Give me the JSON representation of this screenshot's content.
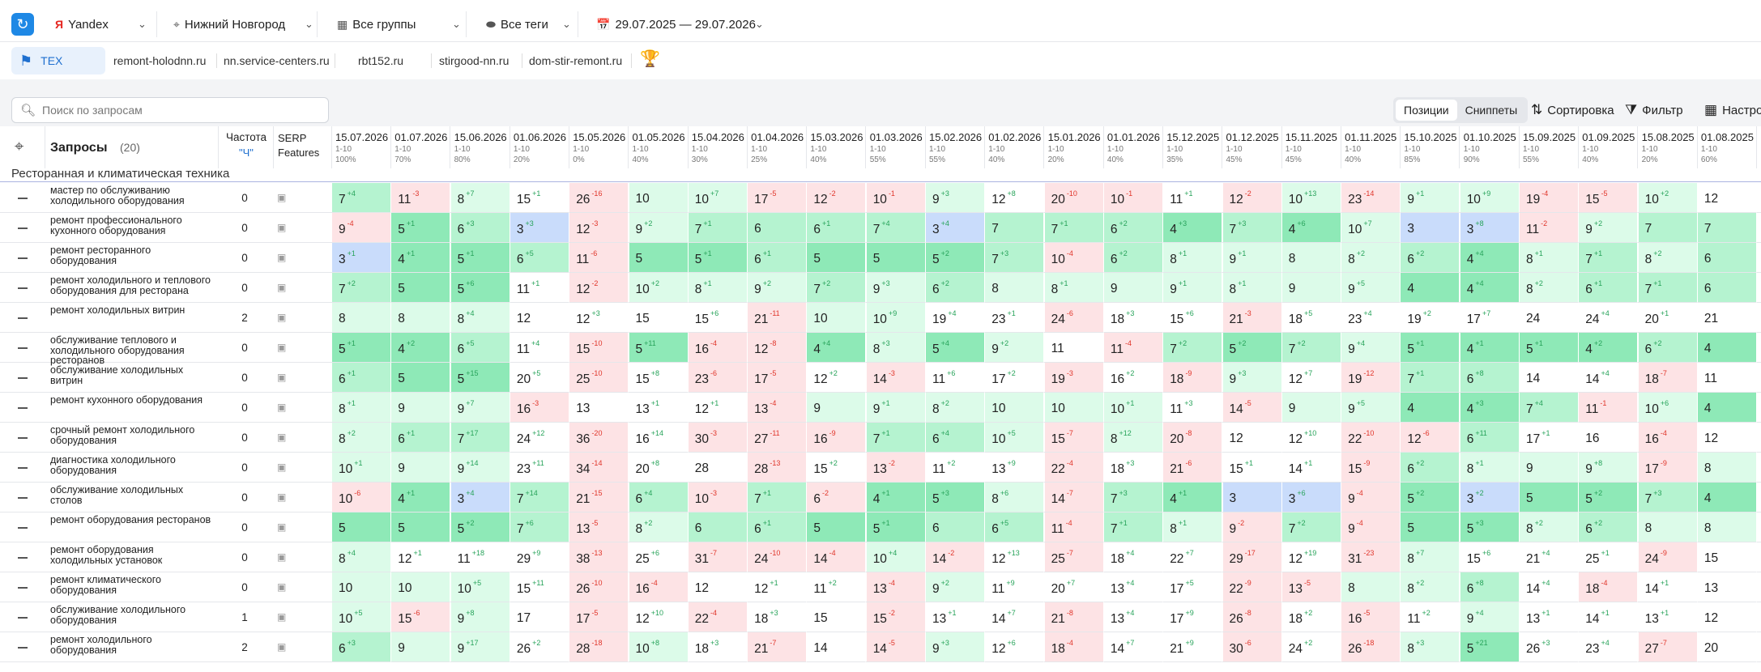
{
  "filters": {
    "engine": "Yandex",
    "region": "Нижний Новгород",
    "groups": "Все группы",
    "tags": "Все теги",
    "dates": "29.07.2025 — 29.07.2026"
  },
  "projects": [
    "TEX",
    "remont-holodnn.ru",
    "nn.service-centers.ru",
    "rbt152.ru",
    "stirgood-nn.ru",
    "dom-stir-remont.ru"
  ],
  "toolbar": {
    "search_placeholder": "Поиск по запросам",
    "positions": "Позиции",
    "snippets": "Сниппеты",
    "sort": "Сортировка",
    "filter": "Фильтр",
    "settings": "Настро"
  },
  "table": {
    "col_queries": "Запросы",
    "queries_count": "(20)",
    "col_freq": "Частота",
    "freq_sub": "\"Ч\"",
    "col_serp": "SERP Features",
    "group": "Ресторанная и климатическая техника",
    "dates": [
      {
        "d": "15.07.2026",
        "r": "1-10",
        "p": "100%"
      },
      {
        "d": "01.07.2026",
        "r": "1-10",
        "p": "70%"
      },
      {
        "d": "15.06.2026",
        "r": "1-10",
        "p": "80%"
      },
      {
        "d": "01.06.2026",
        "r": "1-10",
        "p": "20%"
      },
      {
        "d": "15.05.2026",
        "r": "1-10",
        "p": "0%"
      },
      {
        "d": "01.05.2026",
        "r": "1-10",
        "p": "40%"
      },
      {
        "d": "15.04.2026",
        "r": "1-10",
        "p": "30%"
      },
      {
        "d": "01.04.2026",
        "r": "1-10",
        "p": "25%"
      },
      {
        "d": "15.03.2026",
        "r": "1-10",
        "p": "40%"
      },
      {
        "d": "01.03.2026",
        "r": "1-10",
        "p": "55%"
      },
      {
        "d": "15.02.2026",
        "r": "1-10",
        "p": "55%"
      },
      {
        "d": "01.02.2026",
        "r": "1-10",
        "p": "40%"
      },
      {
        "d": "15.01.2026",
        "r": "1-10",
        "p": "20%"
      },
      {
        "d": "01.01.2026",
        "r": "1-10",
        "p": "40%"
      },
      {
        "d": "15.12.2025",
        "r": "1-10",
        "p": "35%"
      },
      {
        "d": "01.12.2025",
        "r": "1-10",
        "p": "45%"
      },
      {
        "d": "15.11.2025",
        "r": "1-10",
        "p": "45%"
      },
      {
        "d": "01.11.2025",
        "r": "1-10",
        "p": "40%"
      },
      {
        "d": "15.10.2025",
        "r": "1-10",
        "p": "85%"
      },
      {
        "d": "01.10.2025",
        "r": "1-10",
        "p": "90%"
      },
      {
        "d": "15.09.2025",
        "r": "1-10",
        "p": "55%"
      },
      {
        "d": "01.09.2025",
        "r": "1-10",
        "p": "40%"
      },
      {
        "d": "15.08.2025",
        "r": "1-10",
        "p": "20%"
      },
      {
        "d": "01.08.2025",
        "r": "1-10",
        "p": "60%"
      }
    ],
    "rows": [
      {
        "q": "мастер по обслуживанию холодильного оборудования",
        "f": "0",
        "c": [
          "7 +4",
          "11 -3",
          "8 +7",
          "15 +1",
          "26 -16",
          "10",
          "10 +7",
          "17 -5",
          "12 -2",
          "10 -1",
          "9 +3",
          "12 +8",
          "20 -10",
          "10 -1",
          "11 +1",
          "12 -2",
          "10 +13",
          "23 -14",
          "9 +1",
          "10 +9",
          "19 -4",
          "15 -5",
          "10 +2",
          "12"
        ]
      },
      {
        "q": "ремонт профессионального кухонного оборудования",
        "f": "0",
        "c": [
          "9 -4",
          "5 +1",
          "6 +3",
          "3 +3",
          "12 -3",
          "9 +2",
          "7 +1",
          "6",
          "6 +1",
          "7 +4",
          "3 +4",
          "7",
          "7 +1",
          "6 +2",
          "4 +3",
          "7 +3",
          "4 +6",
          "10 +7",
          "3",
          "3 +8",
          "11 -2",
          "9 +2",
          "7",
          "7"
        ]
      },
      {
        "q": "ремонт ресторанного оборудования",
        "f": "0",
        "c": [
          "3 +1",
          "4 +1",
          "5 +1",
          "6 +5",
          "11 -6",
          "5",
          "5 +1",
          "6 +1",
          "5",
          "5",
          "5 +2",
          "7 +3",
          "10 -4",
          "6 +2",
          "8 +1",
          "9 +1",
          "8",
          "8 +2",
          "6 +2",
          "4 +4",
          "8 +1",
          "7 +1",
          "8 +2",
          "6"
        ]
      },
      {
        "q": "ремонт холодильного и теплового оборудования для ресторана",
        "f": "0",
        "c": [
          "7 +2",
          "5",
          "5 +6",
          "11 +1",
          "12 -2",
          "10 +2",
          "8 +1",
          "9 +2",
          "7 +2",
          "9 +3",
          "6 +2",
          "8",
          "8 +1",
          "9",
          "9 +1",
          "8 +1",
          "9",
          "9 +5",
          "4",
          "4 +4",
          "8 +2",
          "6 +1",
          "7 +1",
          "6"
        ]
      },
      {
        "q": "ремонт холодильных витрин",
        "f": "2",
        "c": [
          "8",
          "8",
          "8 +4",
          "12",
          "12 +3",
          "15",
          "15 +6",
          "21 -11",
          "10",
          "10 +9",
          "19 +4",
          "23 +1",
          "24 -6",
          "18 +3",
          "15 +6",
          "21 -3",
          "18 +5",
          "23 +4",
          "19 +2",
          "17 +7",
          "24",
          "24 +4",
          "20 +1",
          "21"
        ]
      },
      {
        "q": "обслуживание теплового и холодильного оборудования ресторанов",
        "f": "0",
        "c": [
          "5 +1",
          "4 +2",
          "6 +5",
          "11 +4",
          "15 -10",
          "5 +11",
          "16 -4",
          "12 -8",
          "4 +4",
          "8 +3",
          "5 +4",
          "9 +2",
          "11",
          "11 -4",
          "7 +2",
          "5 +2",
          "7 +2",
          "9 +4",
          "5 +1",
          "4 +1",
          "5 +1",
          "4 +2",
          "6 +2",
          "4"
        ]
      },
      {
        "q": "обслуживание холодильных витрин",
        "f": "0",
        "c": [
          "6 +1",
          "5",
          "5 +15",
          "20 +5",
          "25 -10",
          "15 +8",
          "23 -6",
          "17 -5",
          "12 +2",
          "14 -3",
          "11 +6",
          "17 +2",
          "19 -3",
          "16 +2",
          "18 -9",
          "9 +3",
          "12 +7",
          "19 -12",
          "7 +1",
          "6 +8",
          "14",
          "14 +4",
          "18 -7",
          "11"
        ]
      },
      {
        "q": "ремонт кухонного оборудования",
        "f": "0",
        "c": [
          "8 +1",
          "9",
          "9 +7",
          "16 -3",
          "13",
          "13 +1",
          "12 +1",
          "13 -4",
          "9",
          "9 +1",
          "8 +2",
          "10",
          "10",
          "10 +1",
          "11 +3",
          "14 -5",
          "9",
          "9 +5",
          "4",
          "4 +3",
          "7 +4",
          "11 -1",
          "10 +6",
          "4"
        ]
      },
      {
        "q": "срочный ремонт холодильного оборудования",
        "f": "0",
        "c": [
          "8 +2",
          "6 +1",
          "7 +17",
          "24 +12",
          "36 -20",
          "16 +14",
          "30 -3",
          "27 -11",
          "16 -9",
          "7 +1",
          "6 +4",
          "10 +5",
          "15 -7",
          "8 +12",
          "20 -8",
          "12",
          "12 +10",
          "22 -10",
          "12 -6",
          "6 +11",
          "17 +1",
          "16",
          "16 -4",
          "12"
        ]
      },
      {
        "q": "диагностика холодильного оборудования",
        "f": "0",
        "c": [
          "10 +1",
          "9",
          "9 +14",
          "23 +11",
          "34 -14",
          "20 +8",
          "28",
          "28 -13",
          "15 +2",
          "13 -2",
          "11 +2",
          "13 +9",
          "22 -4",
          "18 +3",
          "21 -6",
          "15 +1",
          "14 +1",
          "15 -9",
          "6 +2",
          "8 +1",
          "9",
          "9 +8",
          "17 -9",
          "8"
        ]
      },
      {
        "q": "обслуживание холодильных столов",
        "f": "0",
        "c": [
          "10 -6",
          "4 +1",
          "3 +4",
          "7 +14",
          "21 -15",
          "6 +4",
          "10 -3",
          "7 +1",
          "6 -2",
          "4 +1",
          "5 +3",
          "8 +6",
          "14 -7",
          "7 +3",
          "4 +1",
          "3",
          "3 +6",
          "9 -4",
          "5 +2",
          "3 +2",
          "5",
          "5 +2",
          "7 +3",
          "4"
        ]
      },
      {
        "q": "ремонт оборудования ресторанов",
        "f": "0",
        "c": [
          "5",
          "5",
          "5 +2",
          "7 +6",
          "13 -5",
          "8 +2",
          "6",
          "6 +1",
          "5",
          "5 +1",
          "6",
          "6 +5",
          "11 -4",
          "7 +1",
          "8 +1",
          "9 -2",
          "7 +2",
          "9 -4",
          "5",
          "5 +3",
          "8 +2",
          "6 +2",
          "8",
          "8"
        ]
      },
      {
        "q": "ремонт оборудования холодильных установок",
        "f": "0",
        "c": [
          "8 +4",
          "12 +1",
          "11 +18",
          "29 +9",
          "38 -13",
          "25 +6",
          "31 -7",
          "24 -10",
          "14 -4",
          "10 +4",
          "14 -2",
          "12 +13",
          "25 -7",
          "18 +4",
          "22 +7",
          "29 -17",
          "12 +19",
          "31 -23",
          "8 +7",
          "15 +6",
          "21 +4",
          "25 +1",
          "24 -9",
          "15"
        ]
      },
      {
        "q": "ремонт климатического оборудования",
        "f": "0",
        "c": [
          "10",
          "10",
          "10 +5",
          "15 +11",
          "26 -10",
          "16 -4",
          "12",
          "12 +1",
          "11 +2",
          "13 -4",
          "9 +2",
          "11 +9",
          "20 +7",
          "13 +4",
          "17 +5",
          "22 -9",
          "13 -5",
          "8",
          "8 +2",
          "6 +8",
          "14 +4",
          "18 -4",
          "14 +1",
          "13"
        ]
      },
      {
        "q": "обслуживание холодильного оборудования",
        "f": "1",
        "c": [
          "10 +5",
          "15 -6",
          "9 +8",
          "17",
          "17 -5",
          "12 +10",
          "22 -4",
          "18 +3",
          "15",
          "15 -2",
          "13 +1",
          "14 +7",
          "21 -8",
          "13 +4",
          "17 +9",
          "26 -8",
          "18 +2",
          "16 -5",
          "11 +2",
          "9 +4",
          "13 +1",
          "14 +1",
          "13 +1",
          "12"
        ]
      },
      {
        "q": "ремонт холодильного оборудования",
        "f": "2",
        "c": [
          "6 +3",
          "9",
          "9 +17",
          "26 +2",
          "28 -18",
          "10 +8",
          "18 +3",
          "21 -7",
          "14",
          "14 -5",
          "9 +3",
          "12 +6",
          "18 -4",
          "14 +7",
          "21 +9",
          "30 -6",
          "24 +2",
          "26 -18",
          "8 +3",
          "5 +21",
          "26 +3",
          "23 +4",
          "27 -7",
          "20"
        ]
      }
    ]
  }
}
